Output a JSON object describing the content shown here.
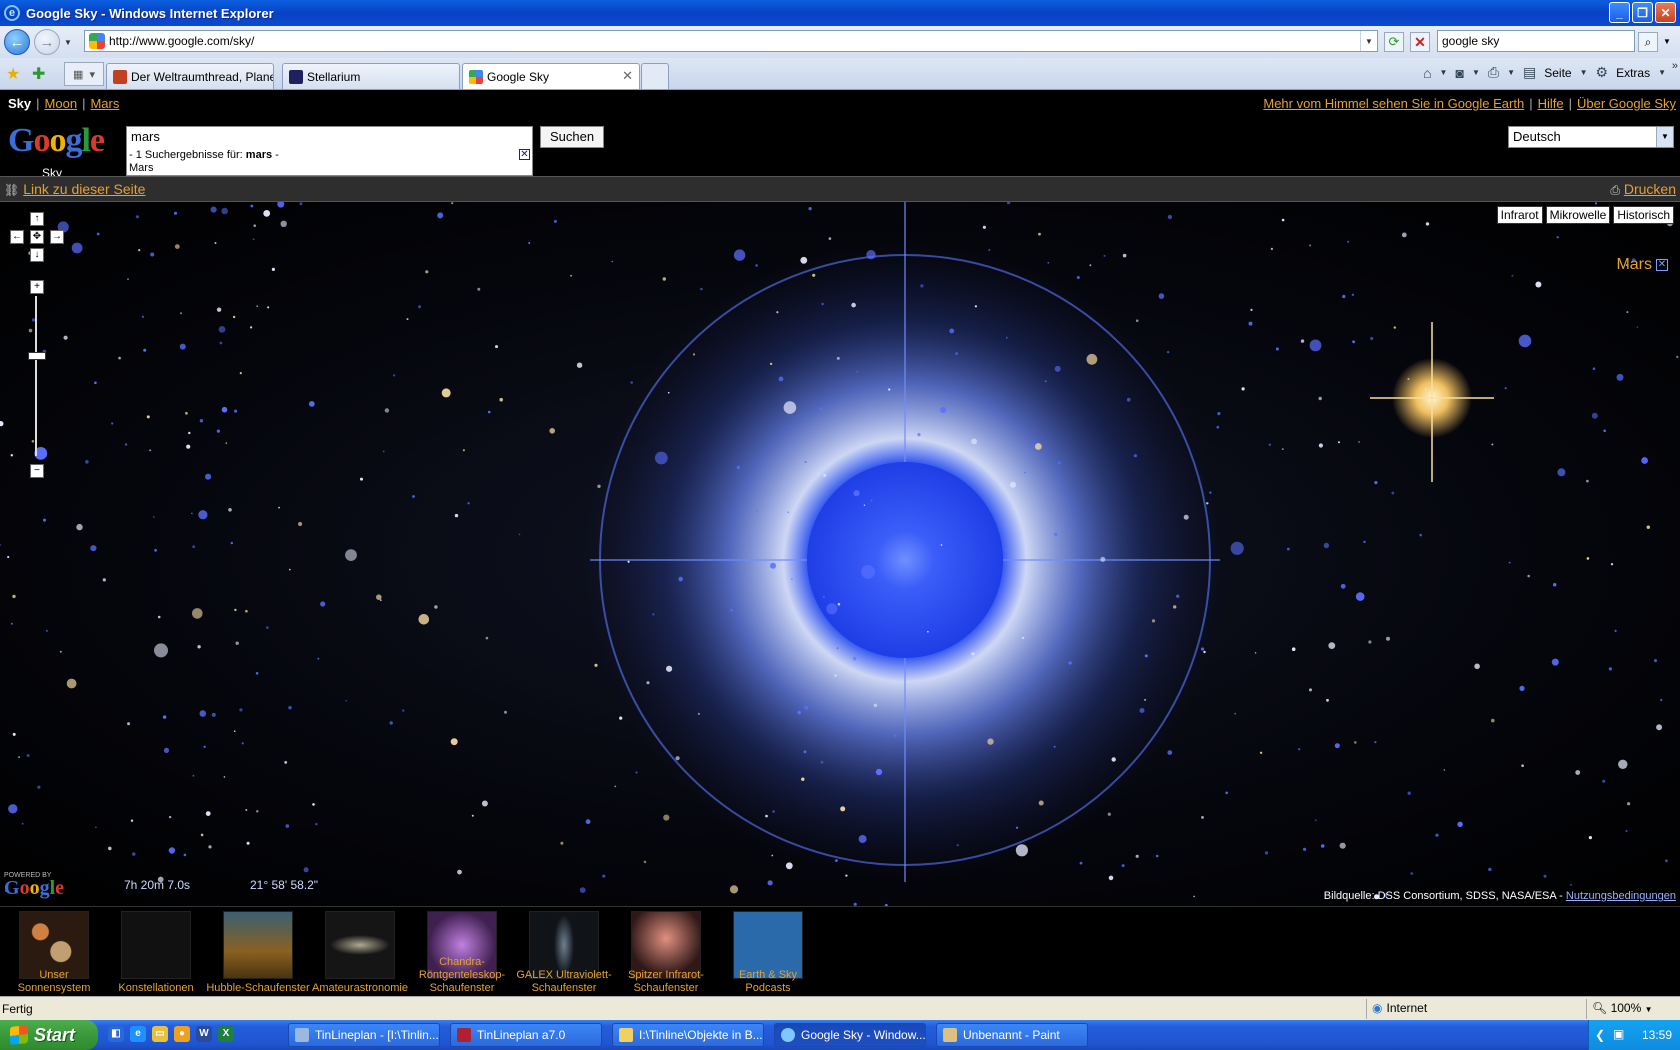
{
  "window": {
    "title": "Google Sky - Windows Internet Explorer",
    "controls": [
      "_",
      "❐",
      "✕"
    ]
  },
  "addressbar": {
    "url": "http://www.google.com/sky/",
    "search_value": "google sky"
  },
  "tabs": [
    {
      "label": "Der Weltraumthread, Planet...",
      "icon_color": "#c04020"
    },
    {
      "label": "Stellarium",
      "icon_color": "#202060"
    },
    {
      "label": "Google Sky",
      "icon_color": "#4285f4",
      "active": true
    }
  ],
  "commandbar": {
    "page_label": "Seite",
    "tools_label": "Extras"
  },
  "sky_nav": {
    "current": "Sky",
    "links": [
      "Moon",
      "Mars"
    ],
    "right_links": [
      "Mehr vom Himmel sehen Sie in Google Earth",
      "Hilfe",
      "Über Google Sky"
    ]
  },
  "header": {
    "logo_letters": [
      {
        "ch": "G",
        "color": "#3b6fd8"
      },
      {
        "ch": "o",
        "color": "#d93a2b"
      },
      {
        "ch": "o",
        "color": "#f0b400"
      },
      {
        "ch": "g",
        "color": "#3b6fd8"
      },
      {
        "ch": "l",
        "color": "#2a9a3a"
      },
      {
        "ch": "e",
        "color": "#d93a2b"
      }
    ],
    "logo_sub": "Sky",
    "query": "mars",
    "suggest_prefix": "- 1 Suchergebnisse für:",
    "suggest_term": "mars",
    "suggest_suffix": "-",
    "suggest_result": "Mars",
    "search_button": "Suchen",
    "language": "Deutsch"
  },
  "linkbar": {
    "link_label": "Link zu dieser Seite",
    "print_label": "Drucken"
  },
  "map": {
    "layers": [
      "Infrarot",
      "Mikrowelle",
      "Historisch"
    ],
    "object_label": "Mars",
    "ra": "7h 20m 7.0s",
    "dec": "21° 58' 58.2\"",
    "powered_by": "POWERED BY",
    "powered_logo": "Google",
    "credit": "Bildquelle: DSS Consortium, SDSS, NASA/ESA -",
    "terms_link": "Nutzungsbedingungen"
  },
  "gallery": [
    {
      "label": "Unser Sonnensystem",
      "thumb": "#2a1a10"
    },
    {
      "label": "Konstellationen",
      "thumb": "#111"
    },
    {
      "label": "Hubble-Schaufenster",
      "thumb": "#4a3410"
    },
    {
      "label": "Amateurastronomie",
      "thumb": "#151515"
    },
    {
      "label": "Chandra-Röntgenteleskop-Schaufenster",
      "thumb": "#402050"
    },
    {
      "label": "GALEX Ultraviolett-Schaufenster",
      "thumb": "#101418"
    },
    {
      "label": "Spitzer Infrarot-Schaufenster",
      "thumb": "#301818"
    },
    {
      "label": "Earth & Sky Podcasts",
      "thumb": "#2a6aaa"
    }
  ],
  "statusbar": {
    "text": "Fertig",
    "zone": "Internet",
    "zoom": "100%"
  },
  "taskbar": {
    "start": "Start",
    "tasks": [
      {
        "label": "TinLineplan - [I:\\Tinlin...",
        "icon": "#9ab8e0"
      },
      {
        "label": "TinLineplan a7.0",
        "icon": "#b02030"
      },
      {
        "label": "I:\\Tinline\\Objekte in B...",
        "icon": "#f0d060"
      },
      {
        "label": "Google Sky - Window...",
        "icon": "#7ec8ff",
        "active": true
      },
      {
        "label": "Unbenannt - Paint",
        "icon": "#e0c080"
      }
    ],
    "clock": "13:59"
  }
}
